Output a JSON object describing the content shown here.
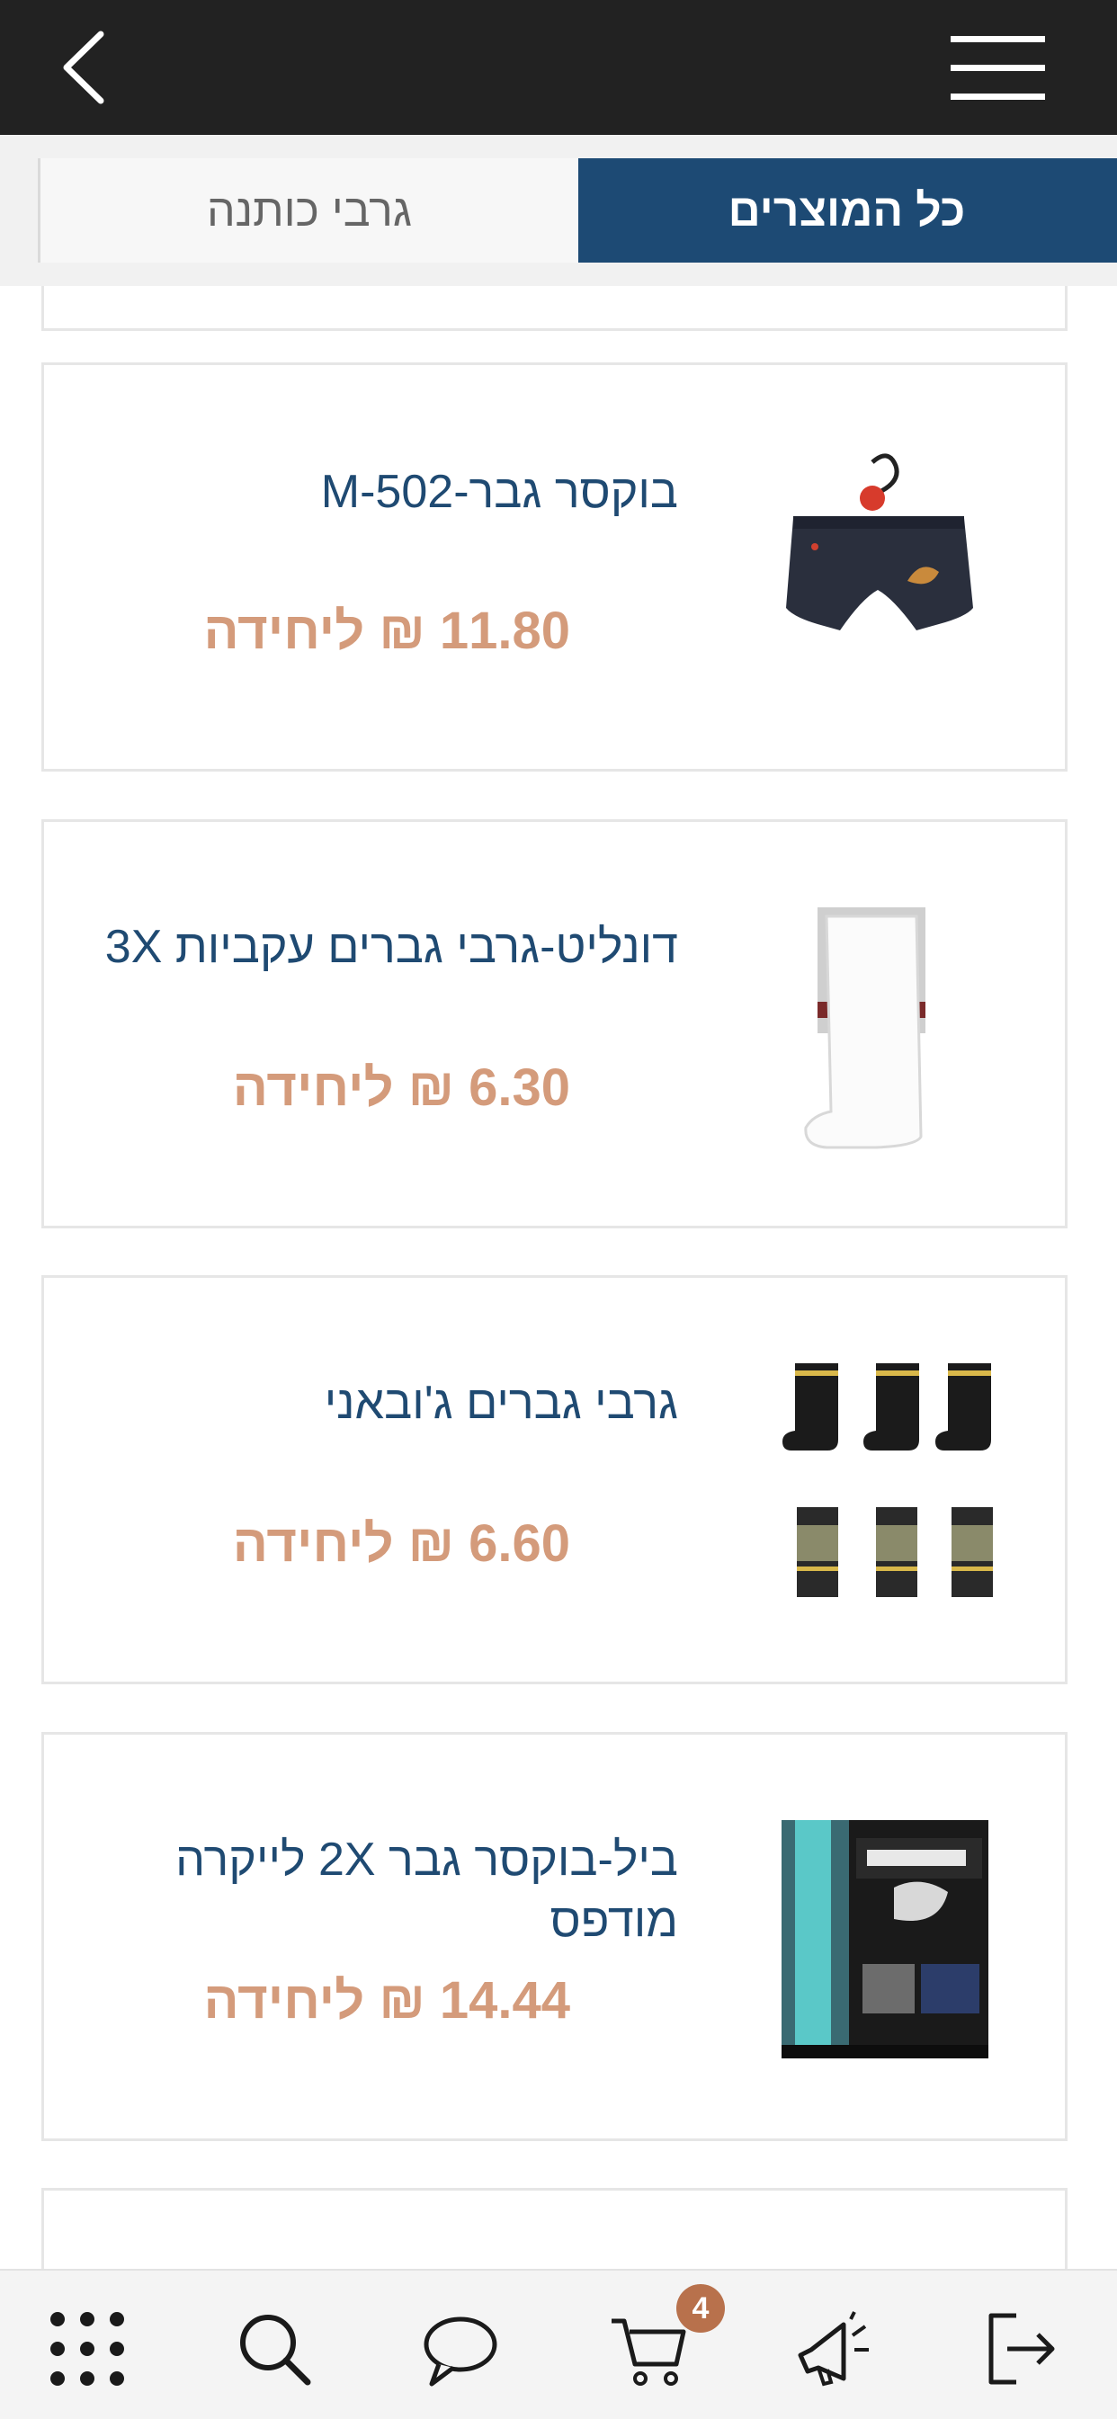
{
  "header": {
    "back_icon": "chevron-left-icon",
    "menu_icon": "hamburger-menu-icon"
  },
  "tabs": [
    {
      "label": "כל המוצרים",
      "active": true
    },
    {
      "label": "גרבי כותנה",
      "active": false
    }
  ],
  "products": [
    {
      "title": "בוקסר גבר-M-502",
      "price": "11.80 ₪ ליחידה",
      "image": "boxer-briefs-image"
    },
    {
      "title": "דונליט-גרבי גברים עקביות 3X",
      "price": "6.30 ₪ ליחידה",
      "image": "white-socks-image"
    },
    {
      "title": "גרבי גברים ג'ובאני",
      "price": "6.60 ₪ ליחידה",
      "image": "black-socks-image"
    },
    {
      "title": "ביל-בוקסר גבר 2X לייקרה מודפס",
      "price": "14.44 ₪ ליחידה",
      "image": "redbuck-boxer-pack-image"
    }
  ],
  "bottom_nav": {
    "items": [
      "apps-grid-icon",
      "search-icon",
      "chat-icon",
      "cart-icon",
      "megaphone-icon",
      "logout-icon"
    ],
    "cart_badge": "4"
  },
  "colors": {
    "header_bg": "#222222",
    "tab_active_bg": "#1d4a74",
    "title_color": "#1f4a72",
    "price_color": "#d49b7b",
    "badge_bg": "#b8714c"
  }
}
